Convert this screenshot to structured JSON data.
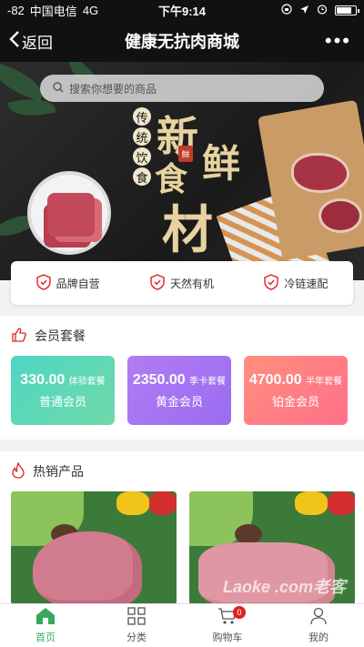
{
  "status_bar": {
    "signal": "-82",
    "carrier": "中国电信",
    "network": "4G",
    "time": "下午9:14"
  },
  "nav": {
    "back_label": "返回",
    "title": "健康无抗肉商城",
    "more_label": "•••"
  },
  "search": {
    "placeholder": "搜索你想要的商品"
  },
  "banner": {
    "text_traditional": [
      "传",
      "统",
      "饮",
      "食"
    ],
    "text_big": [
      "新",
      "鲜",
      "食",
      "材"
    ],
    "stamp": "鲜"
  },
  "features": [
    {
      "label": "品牌自营",
      "icon": "shield-check-icon"
    },
    {
      "label": "天然有机",
      "icon": "shield-check-icon"
    },
    {
      "label": "冷链速配",
      "icon": "shield-check-icon"
    }
  ],
  "membership": {
    "title": "会员套餐",
    "icon": "thumbs-up-icon",
    "cards": [
      {
        "price": "330.00",
        "tag": "体验套餐",
        "name": "普通会员",
        "color_from": "#4fd6c4",
        "color_to": "#6fd9a8"
      },
      {
        "price": "2350.00",
        "tag": "季卡套餐",
        "name": "黄金会员",
        "color_from": "#b07cf3",
        "color_to": "#9b6cf0"
      },
      {
        "price": "4700.00",
        "tag": "半年套餐",
        "name": "铂金会员",
        "color_from": "#ff8f7e",
        "color_to": "#ff6f8a"
      }
    ]
  },
  "hot_products": {
    "title": "热销产品",
    "icon": "flame-icon",
    "watermark": "Laoke .com老客"
  },
  "tabbar": [
    {
      "label": "首页",
      "icon": "home-icon",
      "active": true
    },
    {
      "label": "分类",
      "icon": "grid-icon",
      "active": false
    },
    {
      "label": "购物车",
      "icon": "cart-icon",
      "active": false,
      "badge": "0"
    },
    {
      "label": "我的",
      "icon": "user-icon",
      "active": false
    }
  ],
  "colors": {
    "accent": "#3aa85c",
    "danger": "#e02020"
  }
}
